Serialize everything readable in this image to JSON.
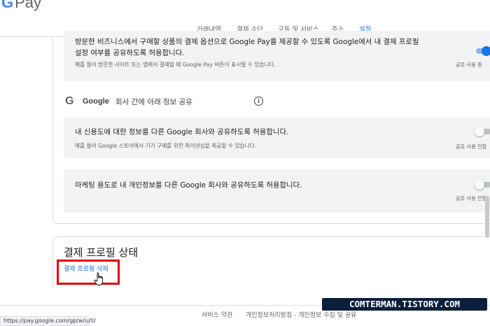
{
  "app": {
    "logo_g": "G",
    "logo_text": "Pay"
  },
  "nav": {
    "tabs": [
      {
        "label": "거래내역"
      },
      {
        "label": "결제 수단"
      },
      {
        "label": "구독 및 서비스"
      },
      {
        "label": "주소"
      },
      {
        "label": "설정",
        "active": true
      }
    ]
  },
  "settings": {
    "merchant": {
      "title_line1": "방문한 비즈니스에서 구매할 상품의 결제 옵션으로 Google Pay를 제공할 수 있도록 Google에서 내 결제 프로필",
      "title_line2": "설정 여부를 공유하도록 허용합니다.",
      "desc": "예를 들어 방문한 사이트 또는 앱에서 결제할 때 Google Pay 버튼이 표시될 수 있습니다.",
      "status": "공유 사용 중",
      "enabled": true
    },
    "google_section": {
      "icon": "G",
      "brand": "Google",
      "title_rest": "회사 간에 아래 정보 공유"
    },
    "credit": {
      "title": "내 신용도에 대한 정보를 다른 Google 회사와 공유하도록 허용합니다.",
      "desc": "예를 들어 Google 스토어에서 기기 구매를 위한 파이낸싱을 제공할 수 있습니다.",
      "status": "공유 사용 안함",
      "enabled": false
    },
    "marketing": {
      "title": "마케팅 용도로 내 개인정보를 다른 Google 회사와 공유하도록 허용합니다.",
      "status": "공유 사용 안함",
      "enabled": false
    }
  },
  "profile_status": {
    "title": "결제 프로필 상태",
    "delete_link": "결제 프로필 삭제"
  },
  "footer": {
    "terms": "서비스 약관",
    "privacy": "개인정보처리방침 - 개인정보 수집 및 공유"
  },
  "status_bar": {
    "url": "https://pay.google.com/gp/w/u/0/"
  },
  "watermark": {
    "text": "COMTERMAN.TISTORY.COM"
  },
  "colors": {
    "accent": "#1a73e8",
    "highlight_box": "#e00000",
    "watermark_bg": "#0b1f3a"
  }
}
